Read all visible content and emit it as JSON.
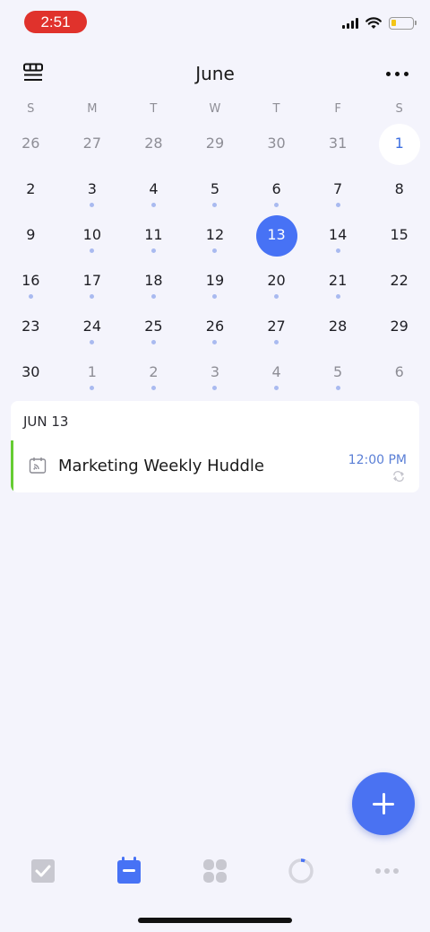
{
  "status_bar": {
    "time": "2:51"
  },
  "header": {
    "title": "June"
  },
  "weekdays": [
    "S",
    "M",
    "T",
    "W",
    "T",
    "F",
    "S"
  ],
  "weeks": [
    [
      {
        "d": "26",
        "muted": true,
        "dot": false
      },
      {
        "d": "27",
        "muted": true,
        "dot": false
      },
      {
        "d": "28",
        "muted": true,
        "dot": false
      },
      {
        "d": "29",
        "muted": true,
        "dot": false
      },
      {
        "d": "30",
        "muted": true,
        "dot": false
      },
      {
        "d": "31",
        "muted": true,
        "dot": false
      },
      {
        "d": "1",
        "muted": false,
        "dot": false,
        "today": true
      }
    ],
    [
      {
        "d": "2",
        "muted": false,
        "dot": false
      },
      {
        "d": "3",
        "muted": false,
        "dot": true
      },
      {
        "d": "4",
        "muted": false,
        "dot": true
      },
      {
        "d": "5",
        "muted": false,
        "dot": true
      },
      {
        "d": "6",
        "muted": false,
        "dot": true
      },
      {
        "d": "7",
        "muted": false,
        "dot": true
      },
      {
        "d": "8",
        "muted": false,
        "dot": false
      }
    ],
    [
      {
        "d": "9",
        "muted": false,
        "dot": false
      },
      {
        "d": "10",
        "muted": false,
        "dot": true
      },
      {
        "d": "11",
        "muted": false,
        "dot": true
      },
      {
        "d": "12",
        "muted": false,
        "dot": true
      },
      {
        "d": "13",
        "muted": false,
        "dot": false,
        "selected": true
      },
      {
        "d": "14",
        "muted": false,
        "dot": true
      },
      {
        "d": "15",
        "muted": false,
        "dot": false
      }
    ],
    [
      {
        "d": "16",
        "muted": false,
        "dot": true
      },
      {
        "d": "17",
        "muted": false,
        "dot": true
      },
      {
        "d": "18",
        "muted": false,
        "dot": true
      },
      {
        "d": "19",
        "muted": false,
        "dot": true
      },
      {
        "d": "20",
        "muted": false,
        "dot": true
      },
      {
        "d": "21",
        "muted": false,
        "dot": true
      },
      {
        "d": "22",
        "muted": false,
        "dot": false
      }
    ],
    [
      {
        "d": "23",
        "muted": false,
        "dot": false
      },
      {
        "d": "24",
        "muted": false,
        "dot": true
      },
      {
        "d": "25",
        "muted": false,
        "dot": true
      },
      {
        "d": "26",
        "muted": false,
        "dot": true
      },
      {
        "d": "27",
        "muted": false,
        "dot": true
      },
      {
        "d": "28",
        "muted": false,
        "dot": false
      },
      {
        "d": "29",
        "muted": false,
        "dot": false
      }
    ],
    [
      {
        "d": "30",
        "muted": false,
        "dot": false
      },
      {
        "d": "1",
        "muted": true,
        "dot": true
      },
      {
        "d": "2",
        "muted": true,
        "dot": true
      },
      {
        "d": "3",
        "muted": true,
        "dot": true
      },
      {
        "d": "4",
        "muted": true,
        "dot": true
      },
      {
        "d": "5",
        "muted": true,
        "dot": true
      },
      {
        "d": "6",
        "muted": true,
        "dot": false
      }
    ]
  ],
  "agenda": {
    "date_label": "JUN 13",
    "events": [
      {
        "title": "Marketing Weekly Huddle",
        "time": "12:00 PM",
        "icon": "calendar-feed-icon",
        "repeat_icon": "repeat-icon"
      }
    ]
  },
  "tabs": [
    {
      "name": "tasks",
      "icon": "checkbox-icon"
    },
    {
      "name": "calendar",
      "icon": "calendar-icon",
      "active": true
    },
    {
      "name": "matrix",
      "icon": "grid-icon"
    },
    {
      "name": "focus",
      "icon": "pomodoro-ring-icon"
    },
    {
      "name": "more",
      "icon": "more-dots-icon"
    }
  ],
  "colors": {
    "accent": "#4772f5",
    "event_accent": "#66cc33",
    "background": "#f4f4fc",
    "dot": "#a9baf0",
    "time_pill": "#e0322c"
  }
}
